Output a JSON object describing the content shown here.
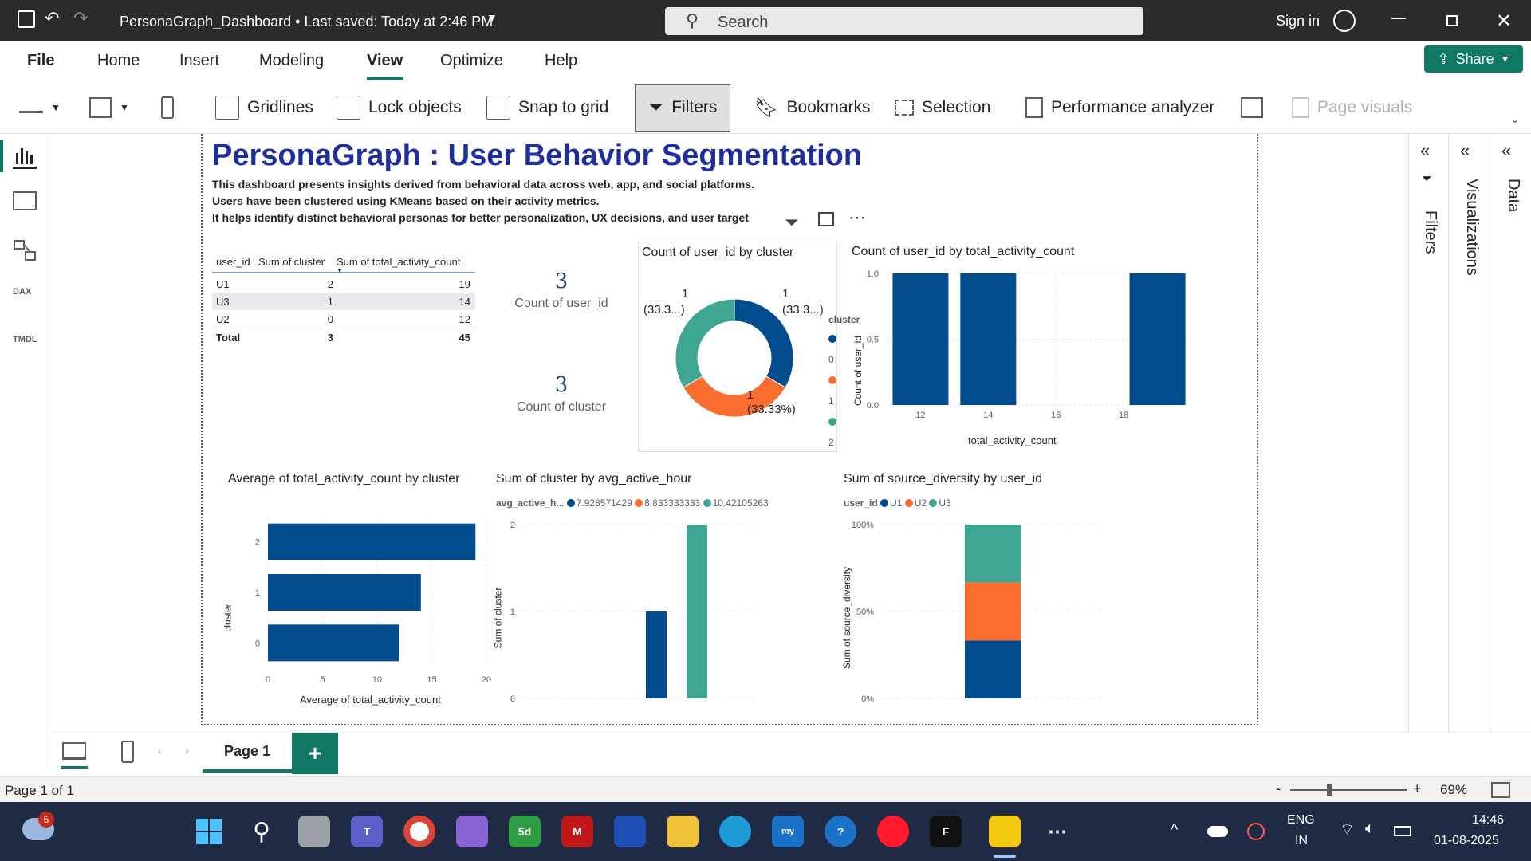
{
  "titlebar": {
    "doc_title": "PersonaGraph_Dashboard • Last saved: Today at 2:46 PM",
    "search_placeholder": "Search",
    "sign_in": "Sign in"
  },
  "menu": {
    "items": [
      "File",
      "Home",
      "Insert",
      "Modeling",
      "View",
      "Optimize",
      "Help"
    ],
    "share": "Share"
  },
  "ribbon": {
    "gridlines": "Gridlines",
    "lock_objects": "Lock objects",
    "snap_to_grid": "Snap to grid",
    "filters": "Filters",
    "bookmarks": "Bookmarks",
    "selection": "Selection",
    "performance_analyzer": "Performance analyzer",
    "page_visuals": "Page visuals"
  },
  "rail": {
    "dax": "DAX",
    "tmdl": "TMDL"
  },
  "report": {
    "title": "PersonaGraph : User Behavior Segmentation",
    "desc1": "This dashboard presents insights derived from behavioral data across web, app, and social platforms.",
    "desc2": "Users have been clustered using KMeans based on their activity metrics.",
    "desc3": "It helps identify distinct behavioral personas for better personalization, UX decisions, and user target",
    "table": {
      "headers": [
        "user_id",
        "Sum of cluster",
        "Sum of total_activity_count"
      ],
      "rows": [
        [
          "U1",
          "2",
          "19"
        ],
        [
          "U3",
          "1",
          "14"
        ],
        [
          "U2",
          "0",
          "12"
        ]
      ],
      "total": [
        "Total",
        "3",
        "45"
      ]
    },
    "card1": {
      "value": "3",
      "label": "Count of user_id"
    },
    "card2": {
      "value": "3",
      "label": "Count of cluster"
    }
  },
  "chart_data": [
    {
      "type": "pie",
      "title": "Count of user_id by cluster",
      "legend_title": "cluster",
      "categories": [
        "0",
        "1",
        "2"
      ],
      "values": [
        1,
        1,
        1
      ],
      "colors": [
        "#004c8c",
        "#fb6d2f",
        "#3ea593"
      ],
      "data_labels": [
        "1",
        "(33.3...)",
        "1",
        "(33.3...)",
        "1",
        "(33.33%)"
      ]
    },
    {
      "type": "bar",
      "title": "Count of user_id by total_activity_count",
      "xlabel": "total_activity_count",
      "ylabel": "Count of user_id",
      "x": [
        12,
        14,
        19
      ],
      "values": [
        1,
        1,
        1
      ],
      "xticks": [
        "12",
        "14",
        "16",
        "18"
      ],
      "yticks": [
        "1.0",
        "0.5",
        "0.0"
      ],
      "ylim": [
        0,
        1
      ]
    },
    {
      "type": "bar",
      "title": "Average of total_activity_count by cluster",
      "orientation": "horizontal",
      "categories": [
        "2",
        "1",
        "0"
      ],
      "values": [
        19,
        14,
        12
      ],
      "xlabel": "Average of total_activity_count",
      "ylabel": "cluster",
      "xticks": [
        "0",
        "5",
        "10",
        "15",
        "20"
      ],
      "xlim": [
        0,
        20
      ]
    },
    {
      "type": "bar",
      "title": "Sum of cluster by avg_active_hour",
      "legend_title": "avg_active_h...",
      "series": [
        {
          "name": "7.928571429",
          "values": [
            0
          ],
          "color": "#004c8c"
        },
        {
          "name": "8.833333333",
          "values": [
            1
          ],
          "color": "#004c8c"
        },
        {
          "name": "10.42105263",
          "values": [
            2
          ],
          "color": "#3ea593"
        }
      ],
      "legend_colors": [
        "#004c8c",
        "#fb6d2f",
        "#3ea593"
      ],
      "ylabel": "Sum of cluster",
      "yticks": [
        "2",
        "1",
        "0"
      ],
      "ylim": [
        0,
        2
      ]
    },
    {
      "type": "bar",
      "title": "Sum of source_diversity by user_id",
      "stacked": "100%",
      "legend_title": "user_id",
      "series": [
        {
          "name": "U1",
          "values": [
            33.3
          ],
          "color": "#004c8c"
        },
        {
          "name": "U2",
          "values": [
            33.3
          ],
          "color": "#fb6d2f"
        },
        {
          "name": "U3",
          "values": [
            33.3
          ],
          "color": "#3ea593"
        }
      ],
      "ylabel": "Sum of source_diversity",
      "yticks": [
        "100%",
        "50%",
        "0%"
      ]
    }
  ],
  "panes": {
    "filters": "Filters",
    "visualizations": "Visualizations",
    "data": "Data"
  },
  "pages": {
    "tab": "Page 1",
    "add": "+"
  },
  "status": {
    "page": "Page 1 of 1",
    "zoom": "69%"
  },
  "taskbar": {
    "badge": "5",
    "lang1": "ENG",
    "lang2": "IN",
    "time": "14:46",
    "date": "01-08-2025"
  }
}
